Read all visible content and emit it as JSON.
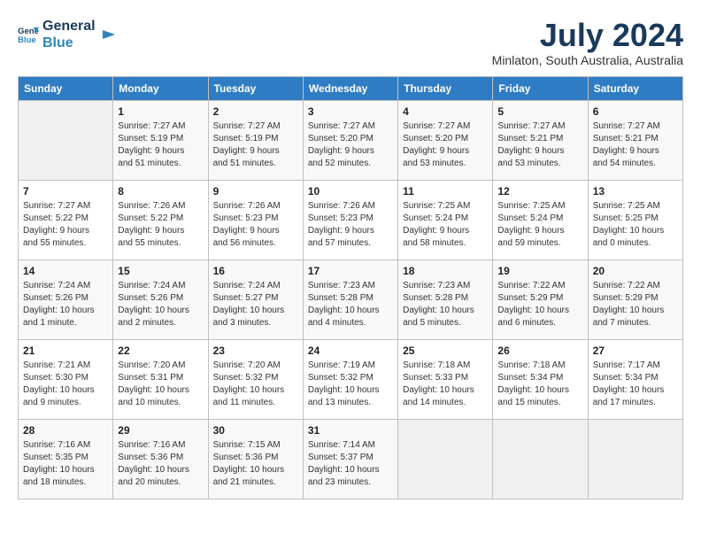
{
  "logo": {
    "line1": "General",
    "line2": "Blue"
  },
  "title": "July 2024",
  "location": "Minlaton, South Australia, Australia",
  "days_header": [
    "Sunday",
    "Monday",
    "Tuesday",
    "Wednesday",
    "Thursday",
    "Friday",
    "Saturday"
  ],
  "weeks": [
    [
      {
        "day": "",
        "info": ""
      },
      {
        "day": "1",
        "info": "Sunrise: 7:27 AM\nSunset: 5:19 PM\nDaylight: 9 hours\nand 51 minutes."
      },
      {
        "day": "2",
        "info": "Sunrise: 7:27 AM\nSunset: 5:19 PM\nDaylight: 9 hours\nand 51 minutes."
      },
      {
        "day": "3",
        "info": "Sunrise: 7:27 AM\nSunset: 5:20 PM\nDaylight: 9 hours\nand 52 minutes."
      },
      {
        "day": "4",
        "info": "Sunrise: 7:27 AM\nSunset: 5:20 PM\nDaylight: 9 hours\nand 53 minutes."
      },
      {
        "day": "5",
        "info": "Sunrise: 7:27 AM\nSunset: 5:21 PM\nDaylight: 9 hours\nand 53 minutes."
      },
      {
        "day": "6",
        "info": "Sunrise: 7:27 AM\nSunset: 5:21 PM\nDaylight: 9 hours\nand 54 minutes."
      }
    ],
    [
      {
        "day": "7",
        "info": "Sunrise: 7:27 AM\nSunset: 5:22 PM\nDaylight: 9 hours\nand 55 minutes."
      },
      {
        "day": "8",
        "info": "Sunrise: 7:26 AM\nSunset: 5:22 PM\nDaylight: 9 hours\nand 55 minutes."
      },
      {
        "day": "9",
        "info": "Sunrise: 7:26 AM\nSunset: 5:23 PM\nDaylight: 9 hours\nand 56 minutes."
      },
      {
        "day": "10",
        "info": "Sunrise: 7:26 AM\nSunset: 5:23 PM\nDaylight: 9 hours\nand 57 minutes."
      },
      {
        "day": "11",
        "info": "Sunrise: 7:25 AM\nSunset: 5:24 PM\nDaylight: 9 hours\nand 58 minutes."
      },
      {
        "day": "12",
        "info": "Sunrise: 7:25 AM\nSunset: 5:24 PM\nDaylight: 9 hours\nand 59 minutes."
      },
      {
        "day": "13",
        "info": "Sunrise: 7:25 AM\nSunset: 5:25 PM\nDaylight: 10 hours\nand 0 minutes."
      }
    ],
    [
      {
        "day": "14",
        "info": "Sunrise: 7:24 AM\nSunset: 5:26 PM\nDaylight: 10 hours\nand 1 minute."
      },
      {
        "day": "15",
        "info": "Sunrise: 7:24 AM\nSunset: 5:26 PM\nDaylight: 10 hours\nand 2 minutes."
      },
      {
        "day": "16",
        "info": "Sunrise: 7:24 AM\nSunset: 5:27 PM\nDaylight: 10 hours\nand 3 minutes."
      },
      {
        "day": "17",
        "info": "Sunrise: 7:23 AM\nSunset: 5:28 PM\nDaylight: 10 hours\nand 4 minutes."
      },
      {
        "day": "18",
        "info": "Sunrise: 7:23 AM\nSunset: 5:28 PM\nDaylight: 10 hours\nand 5 minutes."
      },
      {
        "day": "19",
        "info": "Sunrise: 7:22 AM\nSunset: 5:29 PM\nDaylight: 10 hours\nand 6 minutes."
      },
      {
        "day": "20",
        "info": "Sunrise: 7:22 AM\nSunset: 5:29 PM\nDaylight: 10 hours\nand 7 minutes."
      }
    ],
    [
      {
        "day": "21",
        "info": "Sunrise: 7:21 AM\nSunset: 5:30 PM\nDaylight: 10 hours\nand 9 minutes."
      },
      {
        "day": "22",
        "info": "Sunrise: 7:20 AM\nSunset: 5:31 PM\nDaylight: 10 hours\nand 10 minutes."
      },
      {
        "day": "23",
        "info": "Sunrise: 7:20 AM\nSunset: 5:32 PM\nDaylight: 10 hours\nand 11 minutes."
      },
      {
        "day": "24",
        "info": "Sunrise: 7:19 AM\nSunset: 5:32 PM\nDaylight: 10 hours\nand 13 minutes."
      },
      {
        "day": "25",
        "info": "Sunrise: 7:18 AM\nSunset: 5:33 PM\nDaylight: 10 hours\nand 14 minutes."
      },
      {
        "day": "26",
        "info": "Sunrise: 7:18 AM\nSunset: 5:34 PM\nDaylight: 10 hours\nand 15 minutes."
      },
      {
        "day": "27",
        "info": "Sunrise: 7:17 AM\nSunset: 5:34 PM\nDaylight: 10 hours\nand 17 minutes."
      }
    ],
    [
      {
        "day": "28",
        "info": "Sunrise: 7:16 AM\nSunset: 5:35 PM\nDaylight: 10 hours\nand 18 minutes."
      },
      {
        "day": "29",
        "info": "Sunrise: 7:16 AM\nSunset: 5:36 PM\nDaylight: 10 hours\nand 20 minutes."
      },
      {
        "day": "30",
        "info": "Sunrise: 7:15 AM\nSunset: 5:36 PM\nDaylight: 10 hours\nand 21 minutes."
      },
      {
        "day": "31",
        "info": "Sunrise: 7:14 AM\nSunset: 5:37 PM\nDaylight: 10 hours\nand 23 minutes."
      },
      {
        "day": "",
        "info": ""
      },
      {
        "day": "",
        "info": ""
      },
      {
        "day": "",
        "info": ""
      }
    ]
  ]
}
